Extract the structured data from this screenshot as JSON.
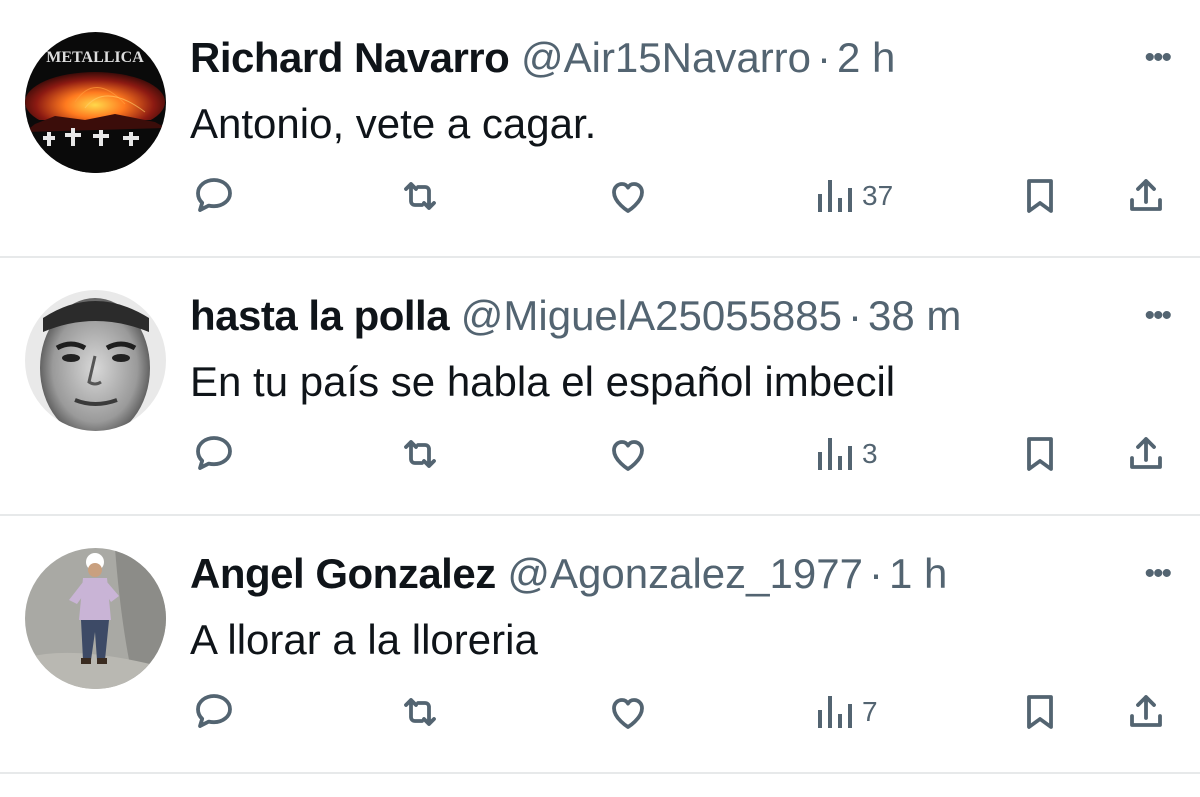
{
  "tweets": [
    {
      "name": "Richard Navarro",
      "handle": "@Air15Navarro",
      "separator": "·",
      "time": "2 h",
      "text": "Antonio, vete a cagar.",
      "views": "37",
      "avatar_icon": "metallica-album-avatar",
      "avatar_logo_text": "METALLICA",
      "avatar_colors": {
        "sky": "#ff5a1f",
        "ground": "#0a0a0a",
        "glow": "#ffd84a"
      }
    },
    {
      "name": "hasta la polla",
      "handle": "@MiguelA25055885",
      "separator": "·",
      "time": "38 m",
      "text": "En tu país se habla el español imbecil",
      "views": "3",
      "avatar_icon": "man-face-avatar"
    },
    {
      "name": "Angel Gonzalez",
      "handle": "@Agonzalez_1977",
      "separator": "·",
      "time": "1 h",
      "text": "A llorar a la lloreria",
      "views": "7",
      "avatar_icon": "worker-photo-avatar"
    }
  ],
  "icons": {
    "more": "more-dots-icon",
    "reply": "reply-icon",
    "retweet": "retweet-icon",
    "like": "heart-icon",
    "views": "views-bars-icon",
    "bookmark": "bookmark-icon",
    "share": "share-icon"
  },
  "colors": {
    "text": "#0f1419",
    "secondary": "#536471",
    "divider": "#e7e9ea"
  }
}
